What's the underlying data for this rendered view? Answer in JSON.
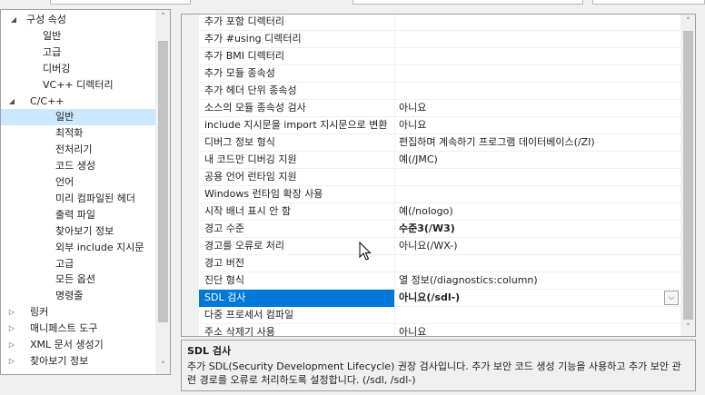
{
  "tree": {
    "items": [
      {
        "label": "구성 속성",
        "toggle": "◢",
        "level": 0,
        "selected": false
      },
      {
        "label": "일반",
        "toggle": "",
        "level": 2,
        "selected": false
      },
      {
        "label": "고급",
        "toggle": "",
        "level": 2,
        "selected": false
      },
      {
        "label": "디버깅",
        "toggle": "",
        "level": 2,
        "selected": false
      },
      {
        "label": "VC++ 디렉터리",
        "toggle": "",
        "level": 2,
        "selected": false
      },
      {
        "label": "C/C++",
        "toggle": "◢",
        "level": 1,
        "selected": false
      },
      {
        "label": "일반",
        "toggle": "",
        "level": 3,
        "selected": true
      },
      {
        "label": "최적화",
        "toggle": "",
        "level": 3,
        "selected": false
      },
      {
        "label": "전처리기",
        "toggle": "",
        "level": 3,
        "selected": false
      },
      {
        "label": "코드 생성",
        "toggle": "",
        "level": 3,
        "selected": false
      },
      {
        "label": "언어",
        "toggle": "",
        "level": 3,
        "selected": false
      },
      {
        "label": "미리 컴파일된 헤더",
        "toggle": "",
        "level": 3,
        "selected": false
      },
      {
        "label": "출력 파일",
        "toggle": "",
        "level": 3,
        "selected": false
      },
      {
        "label": "찾아보기 정보",
        "toggle": "",
        "level": 3,
        "selected": false
      },
      {
        "label": "외부 include 지시문",
        "toggle": "",
        "level": 3,
        "selected": false
      },
      {
        "label": "고급",
        "toggle": "",
        "level": 3,
        "selected": false
      },
      {
        "label": "모든 옵션",
        "toggle": "",
        "level": 3,
        "selected": false
      },
      {
        "label": "명령줄",
        "toggle": "",
        "level": 3,
        "selected": false
      },
      {
        "label": "링커",
        "toggle": "▷",
        "level": 1,
        "selected": false
      },
      {
        "label": "매니페스트 도구",
        "toggle": "▷",
        "level": 1,
        "selected": false
      },
      {
        "label": "XML 문서 생성기",
        "toggle": "▷",
        "level": 1,
        "selected": false
      },
      {
        "label": "찾아보기 정보",
        "toggle": "▷",
        "level": 1,
        "selected": false
      }
    ],
    "scroll_up": "˄",
    "scroll_down": "˅"
  },
  "grid": {
    "rows": [
      {
        "name": "추가 포함 디렉터리",
        "value": "",
        "bold": false
      },
      {
        "name": "추가 #using 디렉터리",
        "value": "",
        "bold": false
      },
      {
        "name": "추가 BMI 디렉터리",
        "value": "",
        "bold": false
      },
      {
        "name": "추가 모듈 종속성",
        "value": "",
        "bold": false
      },
      {
        "name": "추가 헤더 단위 종속성",
        "value": "",
        "bold": false
      },
      {
        "name": "소스의 모듈 종속성 검사",
        "value": "아니요",
        "bold": false
      },
      {
        "name": "include 지시문을 import 지시문으로 변환",
        "value": "아니요",
        "bold": false
      },
      {
        "name": "디버그 정보 형식",
        "value": "편집하며 계속하기 프로그램 데이터베이스(/ZI)",
        "bold": false
      },
      {
        "name": "내 코드만 디버깅 지원",
        "value": "예(/JMC)",
        "bold": false
      },
      {
        "name": "공용 언어 런타임 지원",
        "value": "",
        "bold": false
      },
      {
        "name": "Windows 런타임 확장 사용",
        "value": "",
        "bold": false
      },
      {
        "name": "시작 배너 표시 안 함",
        "value": "예(/nologo)",
        "bold": false
      },
      {
        "name": "경고 수준",
        "value": "수준3(/W3)",
        "bold": true
      },
      {
        "name": "경고를 오류로 처리",
        "value": "아니요(/WX-)",
        "bold": false
      },
      {
        "name": "경고 버전",
        "value": "",
        "bold": false
      },
      {
        "name": "진단 형식",
        "value": "열 정보(/diagnostics:column)",
        "bold": false
      },
      {
        "name": "SDL 검사",
        "value": "아니요(/sdl-)",
        "bold": true
      },
      {
        "name": "다중 프로세서 컴파일",
        "value": "",
        "bold": false
      },
      {
        "name": "주소 삭제기 사용",
        "value": "아니요",
        "bold": false
      }
    ],
    "selected_index": 16,
    "dropdown_glyph": "⌵",
    "scroll_up": "˄",
    "scroll_down": "˅"
  },
  "description": {
    "title": "SDL 검사",
    "text": "추가 SDL(Security Development Lifecycle) 권장 검사입니다. 추가 보안 코드 생성 기능을 사용하고 추가 보안 관련 경로를 오류로 처리하도록 설정합니다. (/sdl, /sdl-)"
  },
  "colors": {
    "selection_accent": "#0078d7",
    "tree_selection": "#cce8ff"
  }
}
